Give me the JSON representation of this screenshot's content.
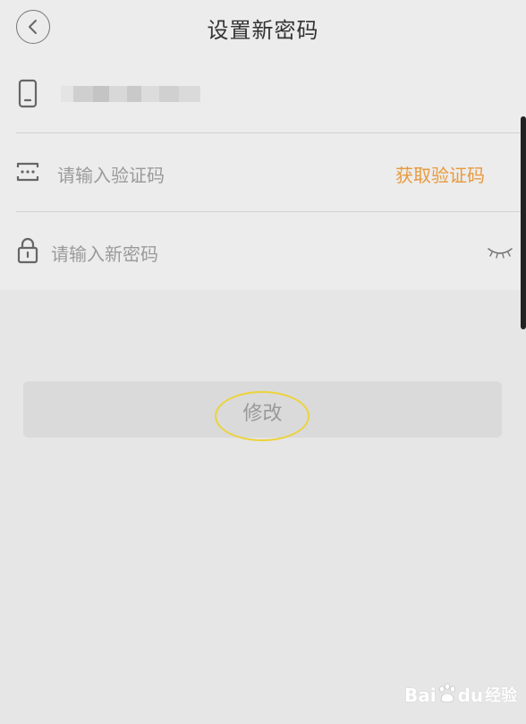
{
  "header": {
    "title": "设置新密码",
    "back_icon": "chevron-left-icon"
  },
  "form": {
    "phone": {
      "icon": "phone-icon",
      "masked": true
    },
    "code": {
      "icon": "verify-code-icon",
      "placeholder": "请输入验证码",
      "get_code_label": "获取验证码",
      "get_code_color": "#e89a3d"
    },
    "password": {
      "icon": "lock-icon",
      "placeholder": "请输入新密码",
      "visibility_icon": "eye-closed-icon"
    }
  },
  "submit": {
    "label": "修改",
    "highlight_color": "#ecd33a"
  },
  "watermark": {
    "brand": "Bai",
    "brand_tail": "du",
    "suffix": "经验"
  }
}
